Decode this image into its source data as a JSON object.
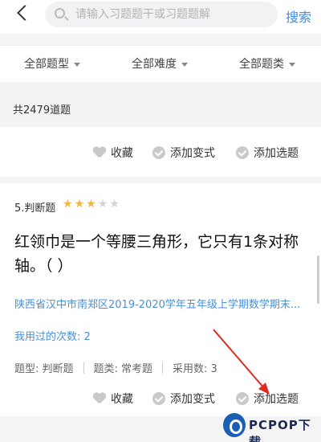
{
  "header": {
    "search_placeholder": "请输入习题题干或习题题解",
    "search_button": "搜索"
  },
  "filters": [
    {
      "label": "全部题型"
    },
    {
      "label": "全部难度"
    },
    {
      "label": "全部题类"
    }
  ],
  "summary": {
    "count_text": "共2479道题"
  },
  "card1": {
    "actions": {
      "favorite": "收藏",
      "add_variant": "添加变式",
      "add_select": "添加选题"
    }
  },
  "card2": {
    "type_label": "5.判断题",
    "difficulty_stars": 3,
    "difficulty_max": 5,
    "question": "红领巾是一个等腰三角形，它只有1条对称轴。（ ）",
    "source": "陕西省汉中市南郑区2019-2020学年五年级上学期数学期末...",
    "used_count": "我用过的次数: 2",
    "meta": {
      "type": "题型: 判断题",
      "category": "题类: 常考题",
      "adoptions": "采用数: 3"
    },
    "actions": {
      "favorite": "收藏",
      "add_variant": "添加变式",
      "add_select": "添加选题"
    }
  },
  "watermark": {
    "brand": "PCPOP下载"
  },
  "colors": {
    "accent": "#3a8ee6",
    "link": "#4a8fd8",
    "star": "#f3b53b",
    "annotation_arrow": "#e0281e"
  }
}
